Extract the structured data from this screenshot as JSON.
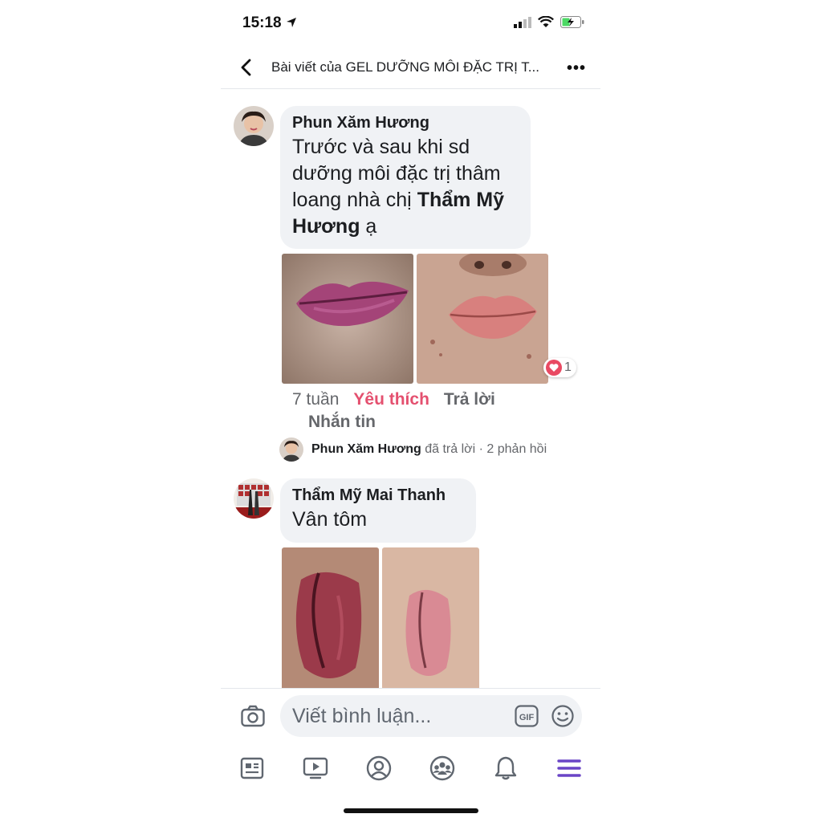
{
  "status_bar": {
    "time": "15:18"
  },
  "header": {
    "title": "Bài viết của GEL DƯỠNG MÔI ĐẶC TRỊ T..."
  },
  "comments": [
    {
      "author": "Phun Xăm Hương",
      "text_plain": "Trước và sau khi sd dưỡng môi đặc trị thâm loang nhà chị ",
      "text_bold": "Thẩm Mỹ Hương",
      "text_tail": " ạ",
      "reaction_count": "1",
      "time": "7 tuần",
      "like_label": "Yêu thích",
      "reply_label": "Trả lời",
      "message_label": "Nhắn tin",
      "reply_summary": {
        "author": "Phun Xăm Hương",
        "action": "đã trả lời",
        "count": "· 2 phản hồi"
      }
    },
    {
      "author": "Thẩm Mỹ Mai Thanh",
      "text_plain": "Vân tôm"
    }
  ],
  "composer": {
    "placeholder": "Viết bình luận..."
  },
  "icons": {
    "back": "chevron-left-icon",
    "more": "more-horizontal-icon",
    "camera": "camera-icon",
    "gif": "gif-icon",
    "emoji": "emoji-icon",
    "tabs": [
      "news-feed-icon",
      "video-icon",
      "profile-icon",
      "groups-icon",
      "notifications-icon",
      "menu-icon"
    ]
  },
  "colors": {
    "like": "#e4506f",
    "menu_active": "#6a45c6",
    "heart": "#e94a63",
    "bubble": "#f0f2f5"
  }
}
